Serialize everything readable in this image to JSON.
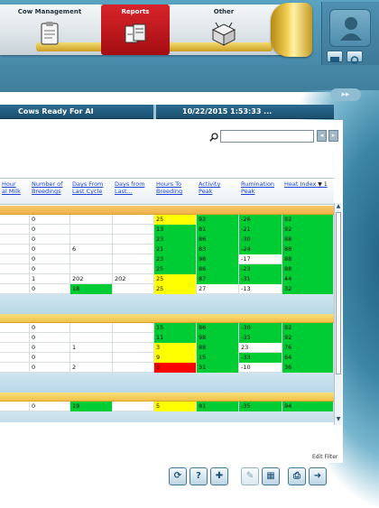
{
  "nav": {
    "tabs": [
      {
        "label": "Cow Management",
        "icon": "clipboard-icon"
      },
      {
        "label": "Reports",
        "icon": "documents-icon",
        "active": true
      },
      {
        "label": "Other",
        "icon": "box-icon"
      }
    ]
  },
  "colors": {
    "accent_red": "#c8141b",
    "header_blue": "#1f5779",
    "group_yellow": "#f3c24a",
    "cell_green": "#00cc33",
    "cell_yellow": "#ffff00",
    "cell_red": "#ff0000",
    "link_blue": "#1c42d6"
  },
  "report": {
    "title": "Cows Ready For AI",
    "datetime": "10/22/2015 1:53:33 ..."
  },
  "search": {
    "value": "",
    "placeholder": ""
  },
  "grid": {
    "columns": [
      {
        "line1": "Hour",
        "line2": "al Milk"
      },
      {
        "line1": "Number of",
        "line2": "Breedings"
      },
      {
        "line1": "Days From",
        "line2": "Last Cycle"
      },
      {
        "line1": "Days from",
        "line2": "Last..."
      },
      {
        "line1": "Hours To",
        "line2": "Breeding"
      },
      {
        "line1": "Activity",
        "line2": "Peak"
      },
      {
        "line1": "Rumination",
        "line2": "Peak"
      },
      {
        "line1": "Heat Index",
        "line2": ""
      }
    ],
    "sort_indicator": "▼ 1",
    "groups": [
      {
        "rows": [
          [
            "",
            "0",
            "",
            "",
            "25",
            "92",
            "-26",
            "92"
          ],
          [
            "",
            "0",
            "",
            "",
            "13",
            "81",
            "-21",
            "92"
          ],
          [
            "",
            "0",
            "",
            "",
            "23",
            "86",
            "-30",
            "88"
          ],
          [
            "",
            "0",
            "6",
            "",
            "21",
            "83",
            "-24",
            "88"
          ],
          [
            "",
            "0",
            "",
            "",
            "23",
            "98",
            "-17",
            "88"
          ],
          [
            "",
            "0",
            "",
            "",
            "25",
            "86",
            "-23",
            "88"
          ],
          [
            "",
            "1",
            "202",
            "202",
            "25",
            "87",
            "-31",
            "44"
          ],
          [
            "",
            "0",
            "18",
            "",
            "25",
            "27",
            "-13",
            "32"
          ]
        ],
        "colors": [
          [
            "",
            "",
            "",
            "",
            "yellow",
            "green",
            "green",
            "green"
          ],
          [
            "",
            "",
            "",
            "",
            "green",
            "green",
            "green",
            "green"
          ],
          [
            "",
            "",
            "",
            "",
            "green",
            "green",
            "green",
            "green"
          ],
          [
            "",
            "",
            "",
            "",
            "green",
            "green",
            "green",
            "green"
          ],
          [
            "",
            "",
            "",
            "",
            "green",
            "green",
            "",
            "green"
          ],
          [
            "",
            "",
            "",
            "",
            "green",
            "green",
            "green",
            "green"
          ],
          [
            "",
            "",
            "",
            "",
            "yellow",
            "green",
            "green",
            "green"
          ],
          [
            "",
            "",
            "green",
            "",
            "yellow",
            "",
            "",
            "green"
          ]
        ]
      },
      {
        "rows": [
          [
            "",
            "0",
            "",
            "",
            "15",
            "86",
            "-30",
            "92"
          ],
          [
            "",
            "0",
            "",
            "",
            "11",
            "98",
            "-33",
            "92"
          ],
          [
            "",
            "0",
            "1",
            "",
            "3",
            "88",
            "23",
            "76"
          ],
          [
            "",
            "0",
            "",
            "",
            "9",
            "15",
            "-33",
            "64"
          ],
          [
            "",
            "0",
            "2",
            "",
            "3",
            "31",
            "-10",
            "36"
          ]
        ],
        "colors": [
          [
            "",
            "",
            "",
            "",
            "green",
            "green",
            "green",
            "green"
          ],
          [
            "",
            "",
            "",
            "",
            "green",
            "green",
            "green",
            "green"
          ],
          [
            "",
            "",
            "",
            "",
            "yellow",
            "green",
            "",
            "green"
          ],
          [
            "",
            "",
            "",
            "",
            "yellow",
            "green",
            "green",
            "green"
          ],
          [
            "",
            "",
            "",
            "",
            "red",
            "green",
            "",
            "green"
          ]
        ]
      },
      {
        "rows": [
          [
            "",
            "0",
            "19",
            "",
            "5",
            "91",
            "-35",
            "94"
          ]
        ],
        "colors": [
          [
            "",
            "",
            "green",
            "",
            "yellow",
            "green",
            "green",
            "green"
          ]
        ]
      }
    ]
  },
  "edit_filter_label": "Edit Filter",
  "toolbar": {
    "buttons": [
      {
        "name": "refresh-button",
        "glyph": "⟳"
      },
      {
        "name": "help-button",
        "glyph": "?"
      },
      {
        "name": "add-button",
        "glyph": "✚"
      },
      {
        "name": "edit-button",
        "glyph": "✎"
      },
      {
        "name": "calendar-button",
        "glyph": "▦"
      },
      {
        "name": "print-button",
        "glyph": "⎙"
      },
      {
        "name": "export-button",
        "glyph": "➜"
      }
    ]
  }
}
